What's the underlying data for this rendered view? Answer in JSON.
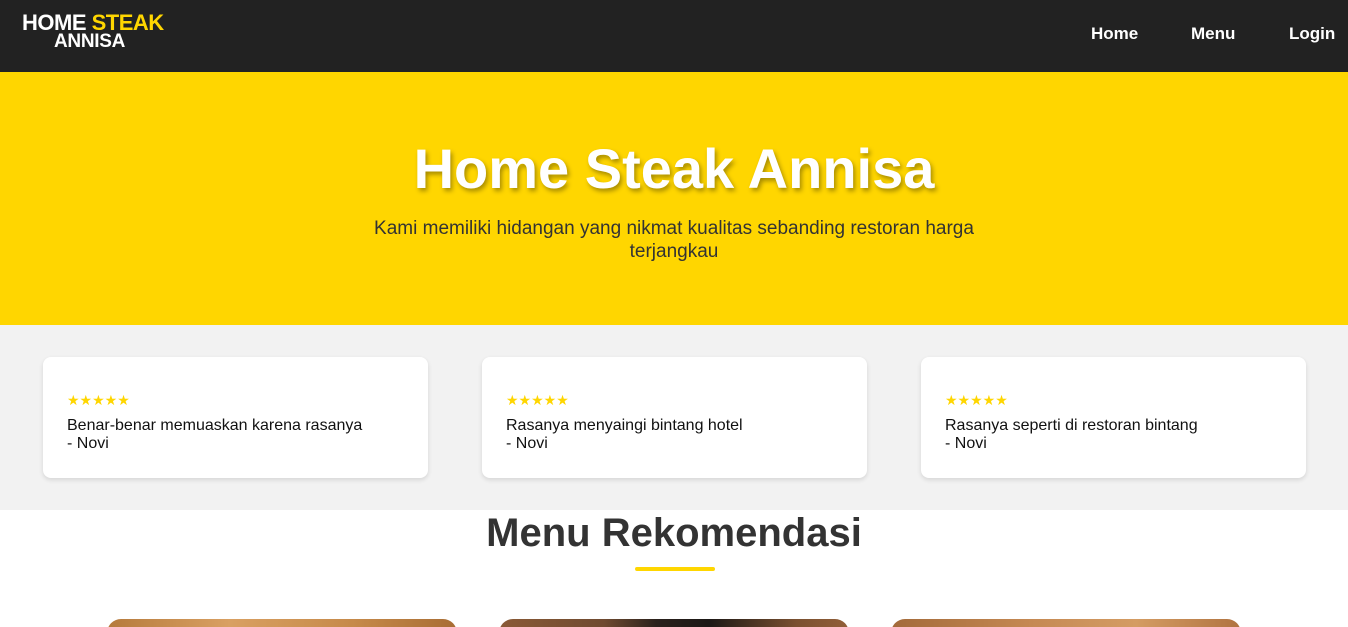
{
  "brand": {
    "line1_white": "HOME",
    "line1_yellow": "STEAK",
    "line2": "ANNISA"
  },
  "nav": {
    "home": "Home",
    "menu": "Menu",
    "login": "Login"
  },
  "hero": {
    "title": "Home Steak Annisa",
    "subtitle": "Kami memiliki hidangan yang nikmat kualitas sebanding restoran harga terjangkau"
  },
  "reviews": [
    {
      "stars": "★★★★★",
      "rating": 5,
      "text": "Benar-benar memuaskan karena rasanya",
      "author": "- Novi"
    },
    {
      "stars": "★★★★★",
      "rating": 5,
      "text": "Rasanya menyaingi bintang hotel",
      "author": "- Novi"
    },
    {
      "stars": "★★★★★",
      "rating": 5,
      "text": "Rasanya seperti di restoran bintang",
      "author": "- Novi"
    }
  ],
  "menu_section": {
    "title": "Menu Rekomendasi"
  },
  "colors": {
    "accent": "#ffd600",
    "navbar": "#222222",
    "reviews_bg": "#f2f2f2"
  }
}
